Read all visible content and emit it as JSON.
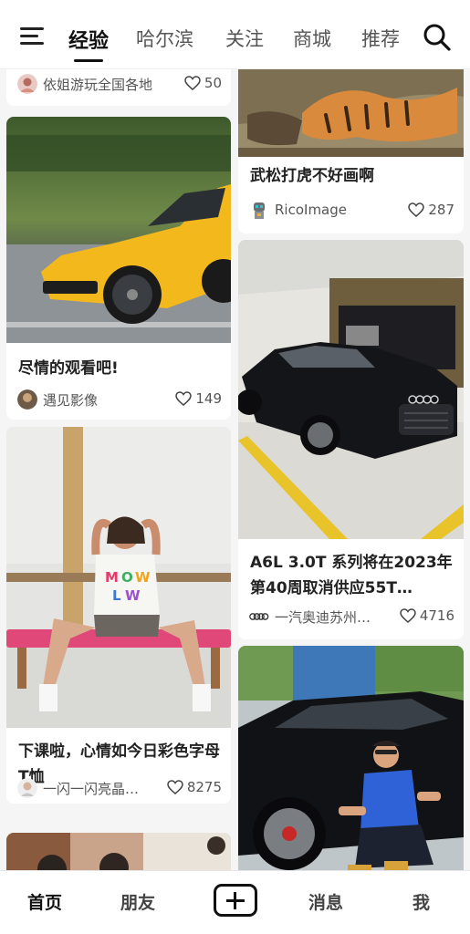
{
  "top_nav": {
    "tabs": [
      {
        "label": "经验",
        "active": true
      },
      {
        "label": "哈尔滨",
        "active": false
      },
      {
        "label": "关注",
        "active": false
      },
      {
        "label": "商城",
        "active": false
      },
      {
        "label": "推荐",
        "active": false
      }
    ],
    "menu_icon": "menu-icon",
    "search_icon": "search-icon"
  },
  "feed": {
    "left": [
      {
        "title": "",
        "author": "依姐游玩全国各地",
        "likes": "50",
        "image": "partial-top"
      },
      {
        "title": "尽情的观看吧!",
        "author": "遇见影像",
        "likes": "149",
        "image": "yellow-suv-photo"
      },
      {
        "title": "下课啦，心情如今日彩色字母T恤",
        "author": "一闪一闪亮晶…",
        "likes": "8275",
        "image": "woman-bench-photo"
      },
      {
        "title": "",
        "author": "",
        "likes": "",
        "image": "people-photo-partial"
      }
    ],
    "right": [
      {
        "title": "武松打虎不好画啊",
        "author": "RicoImage",
        "likes": "287",
        "image": "tiger-painting"
      },
      {
        "title": "A6L 3.0T 系列将在2023年第40周取消供应55T…",
        "author": "一汽奥迪苏州…",
        "likes": "4716",
        "image": "black-audi-showroom"
      },
      {
        "title": "",
        "author": "",
        "likes": "",
        "image": "man-black-suv-photo"
      }
    ]
  },
  "bottom_nav": {
    "items": [
      {
        "label": "首页",
        "active": true
      },
      {
        "label": "朋友",
        "active": false
      },
      {
        "label": "消息",
        "active": false
      },
      {
        "label": "我",
        "active": false
      }
    ],
    "plus_icon": "plus-icon"
  },
  "colors": {
    "accent": "#111111",
    "background": "#f5f5f5",
    "card": "#ffffff",
    "car_yellow": "#f2b81c"
  }
}
